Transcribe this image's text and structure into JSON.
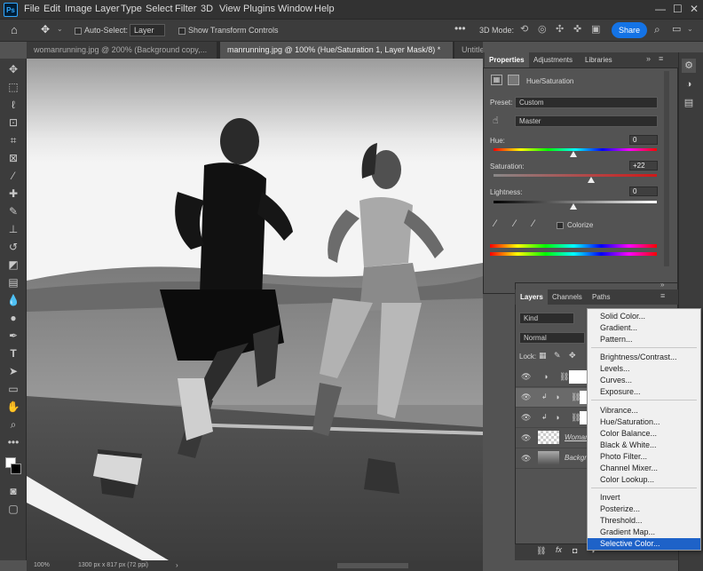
{
  "app": {
    "logo": "Ps"
  },
  "menubar": {
    "items": [
      "File",
      "Edit",
      "Image",
      "Layer",
      "Type",
      "Select",
      "Filter",
      "3D",
      "View",
      "Plugins",
      "Window",
      "Help"
    ]
  },
  "window_controls": {
    "minimize": "—",
    "maximize": "☐",
    "close": "✕"
  },
  "options": {
    "auto_select_label": "Auto-Select:",
    "auto_select_value": "Layer",
    "show_transform_label": "Show Transform Controls",
    "mode_3d_label": "3D Mode:",
    "share_label": "Share"
  },
  "tabs": [
    {
      "label": "womanrunning.jpg @ 200% (Background copy,...",
      "active": false
    },
    {
      "label": "manrunning.jpg @ 100% (Hue/Saturation 1, Layer Mask/8) *",
      "active": true
    },
    {
      "label": "Untitle",
      "active": false
    }
  ],
  "properties": {
    "tabs": [
      "Properties",
      "Adjustments",
      "Libraries"
    ],
    "adjustment_title": "Hue/Saturation",
    "preset_label": "Preset:",
    "preset_value": "Custom",
    "channel_value": "Master",
    "hue_label": "Hue:",
    "hue_value": "0",
    "saturation_label": "Saturation:",
    "saturation_value": "+22",
    "lightness_label": "Lightness:",
    "lightness_value": "0",
    "colorize_label": "Colorize"
  },
  "layers_panel": {
    "tabs": [
      "Layers",
      "Channels",
      "Paths"
    ],
    "filter_value": "Kind",
    "blend_mode": "Normal",
    "lock_label": "Lock:",
    "layer_names": [
      "Woman",
      "Backgr"
    ]
  },
  "status": {
    "zoom": "100%",
    "doc_info": "1300 px x 817 px (72 ppi)"
  },
  "context_menu": {
    "groups": [
      [
        "Solid Color...",
        "Gradient...",
        "Pattern..."
      ],
      [
        "Brightness/Contrast...",
        "Levels...",
        "Curves...",
        "Exposure..."
      ],
      [
        "Vibrance...",
        "Hue/Saturation...",
        "Color Balance...",
        "Black & White...",
        "Photo Filter...",
        "Channel Mixer...",
        "Color Lookup..."
      ],
      [
        "Invert",
        "Posterize...",
        "Threshold...",
        "Gradient Map...",
        "Selective Color..."
      ]
    ],
    "highlighted": "Selective Color..."
  },
  "colors": {
    "accent": "#1473e6",
    "menu_highlight": "#1e62c8",
    "panel_bg": "#535353",
    "toolbar_bg": "#3c3c3c"
  },
  "icons": [
    "home-icon",
    "move-icon",
    "marquee-icon",
    "lasso-icon",
    "crop-icon",
    "eyedropper-icon",
    "brush-icon",
    "eraser-icon",
    "pen-icon",
    "type-icon",
    "zoom-icon",
    "hand-icon",
    "search-icon"
  ]
}
